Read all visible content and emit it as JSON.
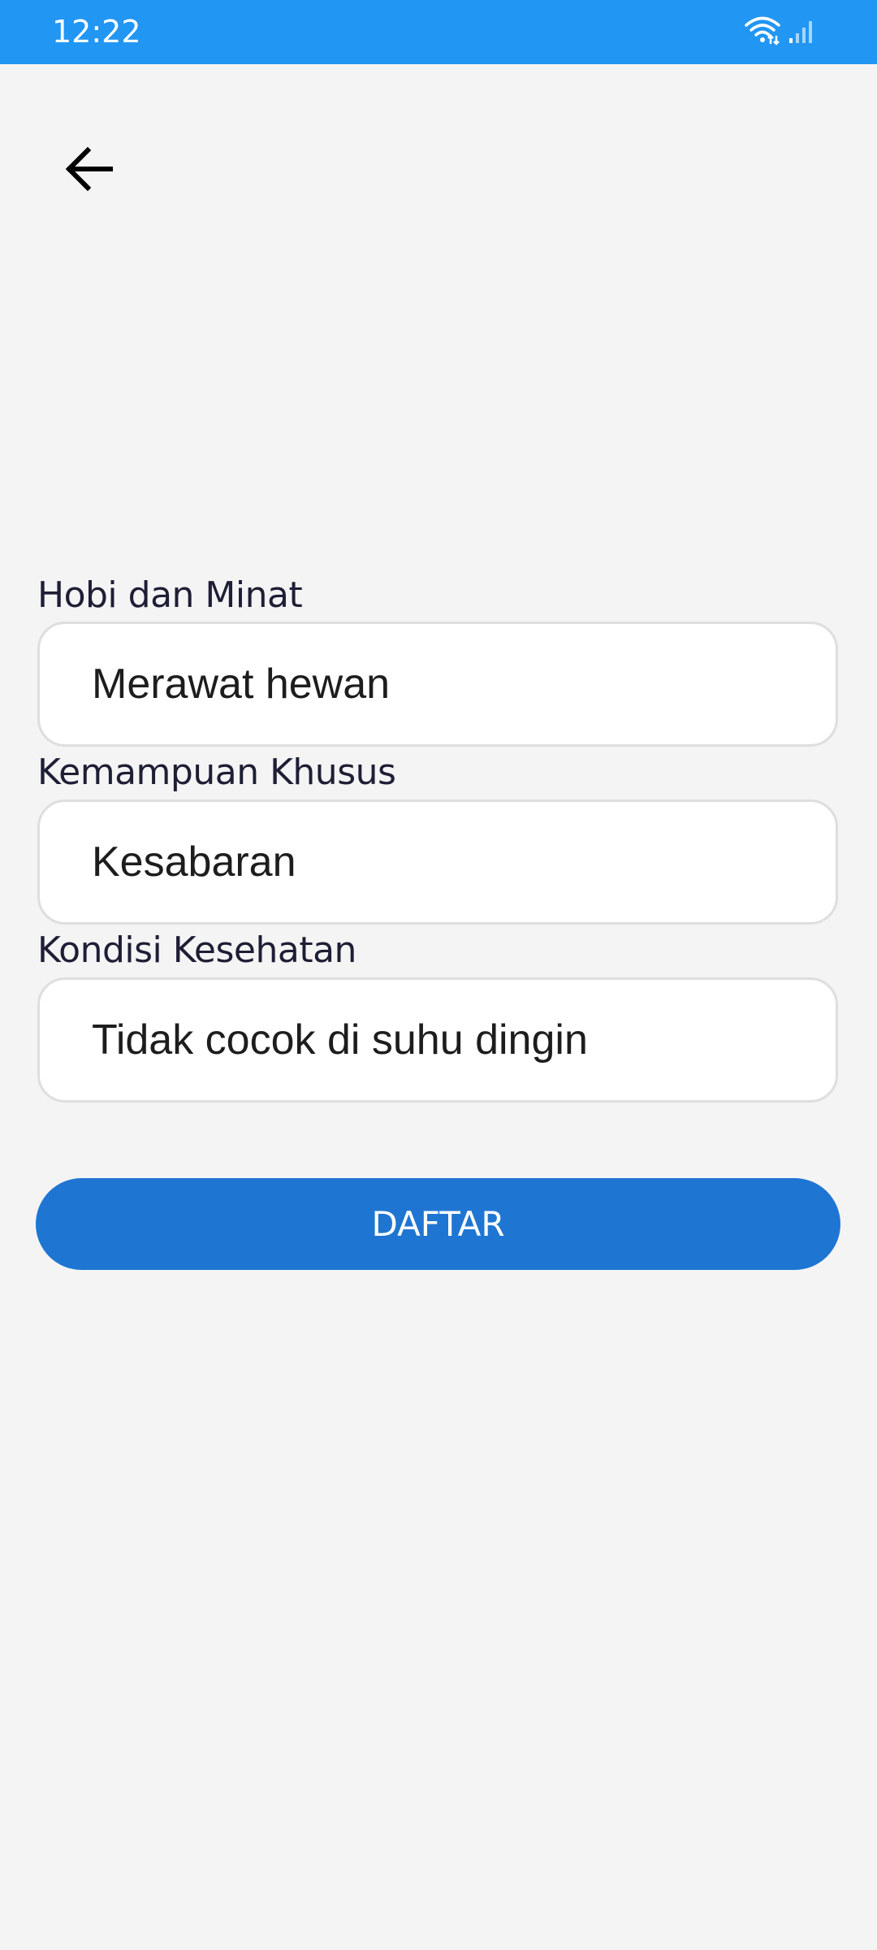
{
  "status_bar": {
    "time": "12:22",
    "bg_color": "#2196f3",
    "icons": [
      "wifi-icon",
      "signal-icon"
    ]
  },
  "header": {
    "back_icon": "arrow-left-icon"
  },
  "form": {
    "fields": [
      {
        "label": "Hobi dan Minat",
        "value": "Merawat hewan",
        "placeholder": ""
      },
      {
        "label": "Kemampuan Khusus",
        "value": "Kesabaran",
        "placeholder": ""
      },
      {
        "label": "Kondisi Kesehatan",
        "value": "Tidak cocok di suhu dingin",
        "placeholder": ""
      }
    ]
  },
  "submit": {
    "label": "DAFTAR",
    "color": "#1f76d2"
  }
}
